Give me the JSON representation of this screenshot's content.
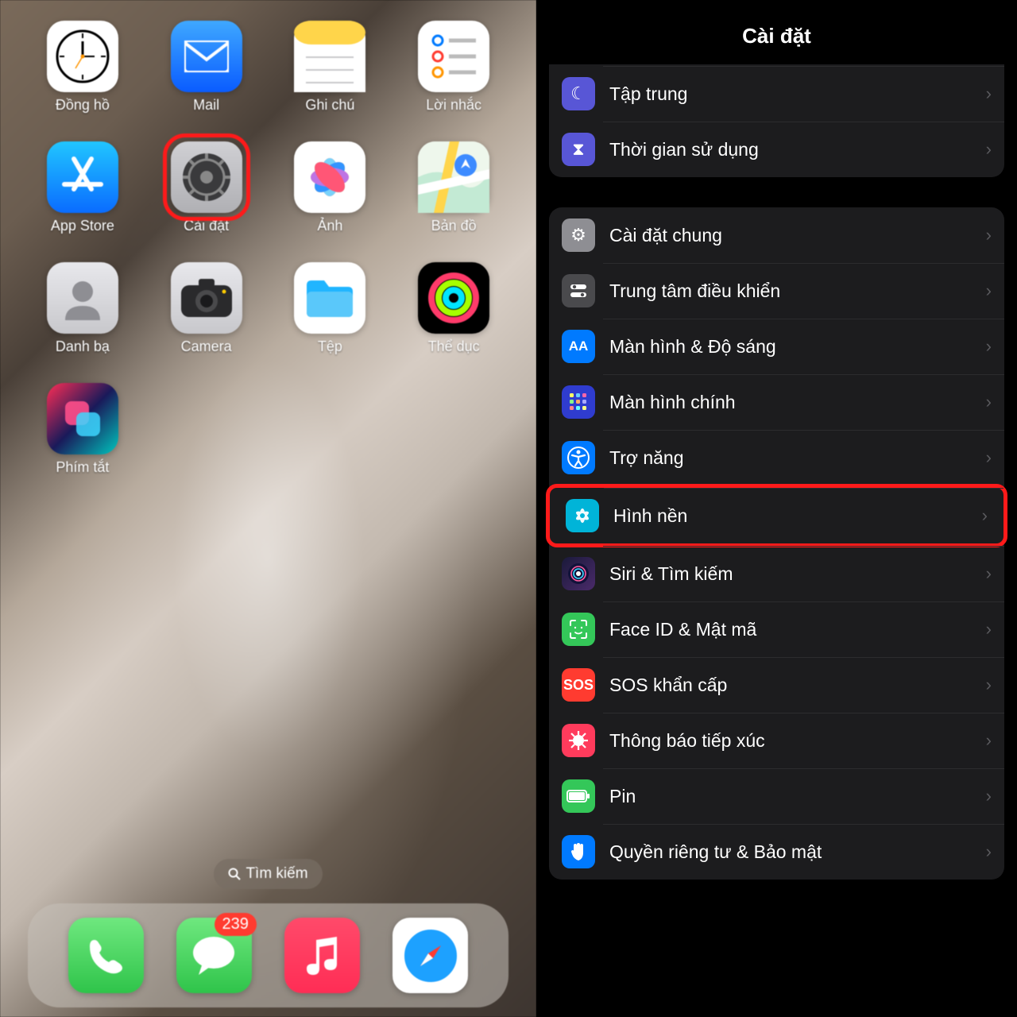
{
  "homescreen": {
    "apps": [
      {
        "id": "clock",
        "label": "Đồng hồ",
        "icon": "clock-icon"
      },
      {
        "id": "mail",
        "label": "Mail",
        "icon": "mail-icon"
      },
      {
        "id": "notes",
        "label": "Ghi chú",
        "icon": "notes-icon"
      },
      {
        "id": "reminders",
        "label": "Lời nhắc",
        "icon": "reminders-icon"
      },
      {
        "id": "appstore",
        "label": "App Store",
        "icon": "appstore-icon"
      },
      {
        "id": "settings",
        "label": "Cài đặt",
        "icon": "settings-app-icon",
        "highlighted": true
      },
      {
        "id": "photos",
        "label": "Ảnh",
        "icon": "photos-icon"
      },
      {
        "id": "maps",
        "label": "Bản đồ",
        "icon": "maps-icon"
      },
      {
        "id": "contacts",
        "label": "Danh bạ",
        "icon": "contacts-icon"
      },
      {
        "id": "camera",
        "label": "Camera",
        "icon": "camera-icon"
      },
      {
        "id": "files",
        "label": "Tệp",
        "icon": "files-icon"
      },
      {
        "id": "fitness",
        "label": "Thể dục",
        "icon": "fitness-icon"
      },
      {
        "id": "shortcuts",
        "label": "Phím tắt",
        "icon": "shortcuts-icon"
      }
    ],
    "search_label": "Tìm kiếm",
    "dock": [
      {
        "id": "phone",
        "icon": "phone-icon"
      },
      {
        "id": "messages",
        "icon": "messages-icon",
        "badge": "239"
      },
      {
        "id": "music",
        "icon": "music-icon"
      },
      {
        "id": "safari",
        "icon": "safari-icon"
      }
    ]
  },
  "settings": {
    "title": "Cài đặt",
    "section_top": [
      {
        "id": "focus",
        "label": "Tập trung",
        "icon_class": "ic-focus",
        "glyph": "☾"
      },
      {
        "id": "screentime",
        "label": "Thời gian sử dụng",
        "icon_class": "ic-screentime",
        "glyph": "⧗"
      }
    ],
    "section_main": [
      {
        "id": "general",
        "label": "Cài đặt chung",
        "icon_class": "ic-general",
        "glyph": "⚙"
      },
      {
        "id": "control",
        "label": "Trung tâm điều khiển",
        "icon_class": "ic-control",
        "glyph": "⊟"
      },
      {
        "id": "display",
        "label": "Màn hình & Độ sáng",
        "icon_class": "ic-display",
        "glyph": "AA"
      },
      {
        "id": "home",
        "label": "Màn hình chính",
        "icon_class": "ic-home",
        "glyph": "▦"
      },
      {
        "id": "accessibility",
        "label": "Trợ năng",
        "icon_class": "ic-access",
        "glyph": "⦿"
      },
      {
        "id": "wallpaper",
        "label": "Hình nền",
        "icon_class": "ic-wallpaper",
        "glyph": "❀",
        "highlighted": true
      },
      {
        "id": "siri",
        "label": "Siri & Tìm kiếm",
        "icon_class": "ic-siri",
        "glyph": "◉"
      },
      {
        "id": "faceid",
        "label": "Face ID & Mật mã",
        "icon_class": "ic-faceid",
        "glyph": "☺"
      },
      {
        "id": "sos",
        "label": "SOS khẩn cấp",
        "icon_class": "ic-sos",
        "glyph": "SOS"
      },
      {
        "id": "exposure",
        "label": "Thông báo tiếp xúc",
        "icon_class": "ic-exposure",
        "glyph": "⊛"
      },
      {
        "id": "battery",
        "label": "Pin",
        "icon_class": "ic-battery",
        "glyph": "▮"
      },
      {
        "id": "privacy",
        "label": "Quyền riêng tư & Bảo mật",
        "icon_class": "ic-privacy",
        "glyph": "✋"
      }
    ]
  }
}
